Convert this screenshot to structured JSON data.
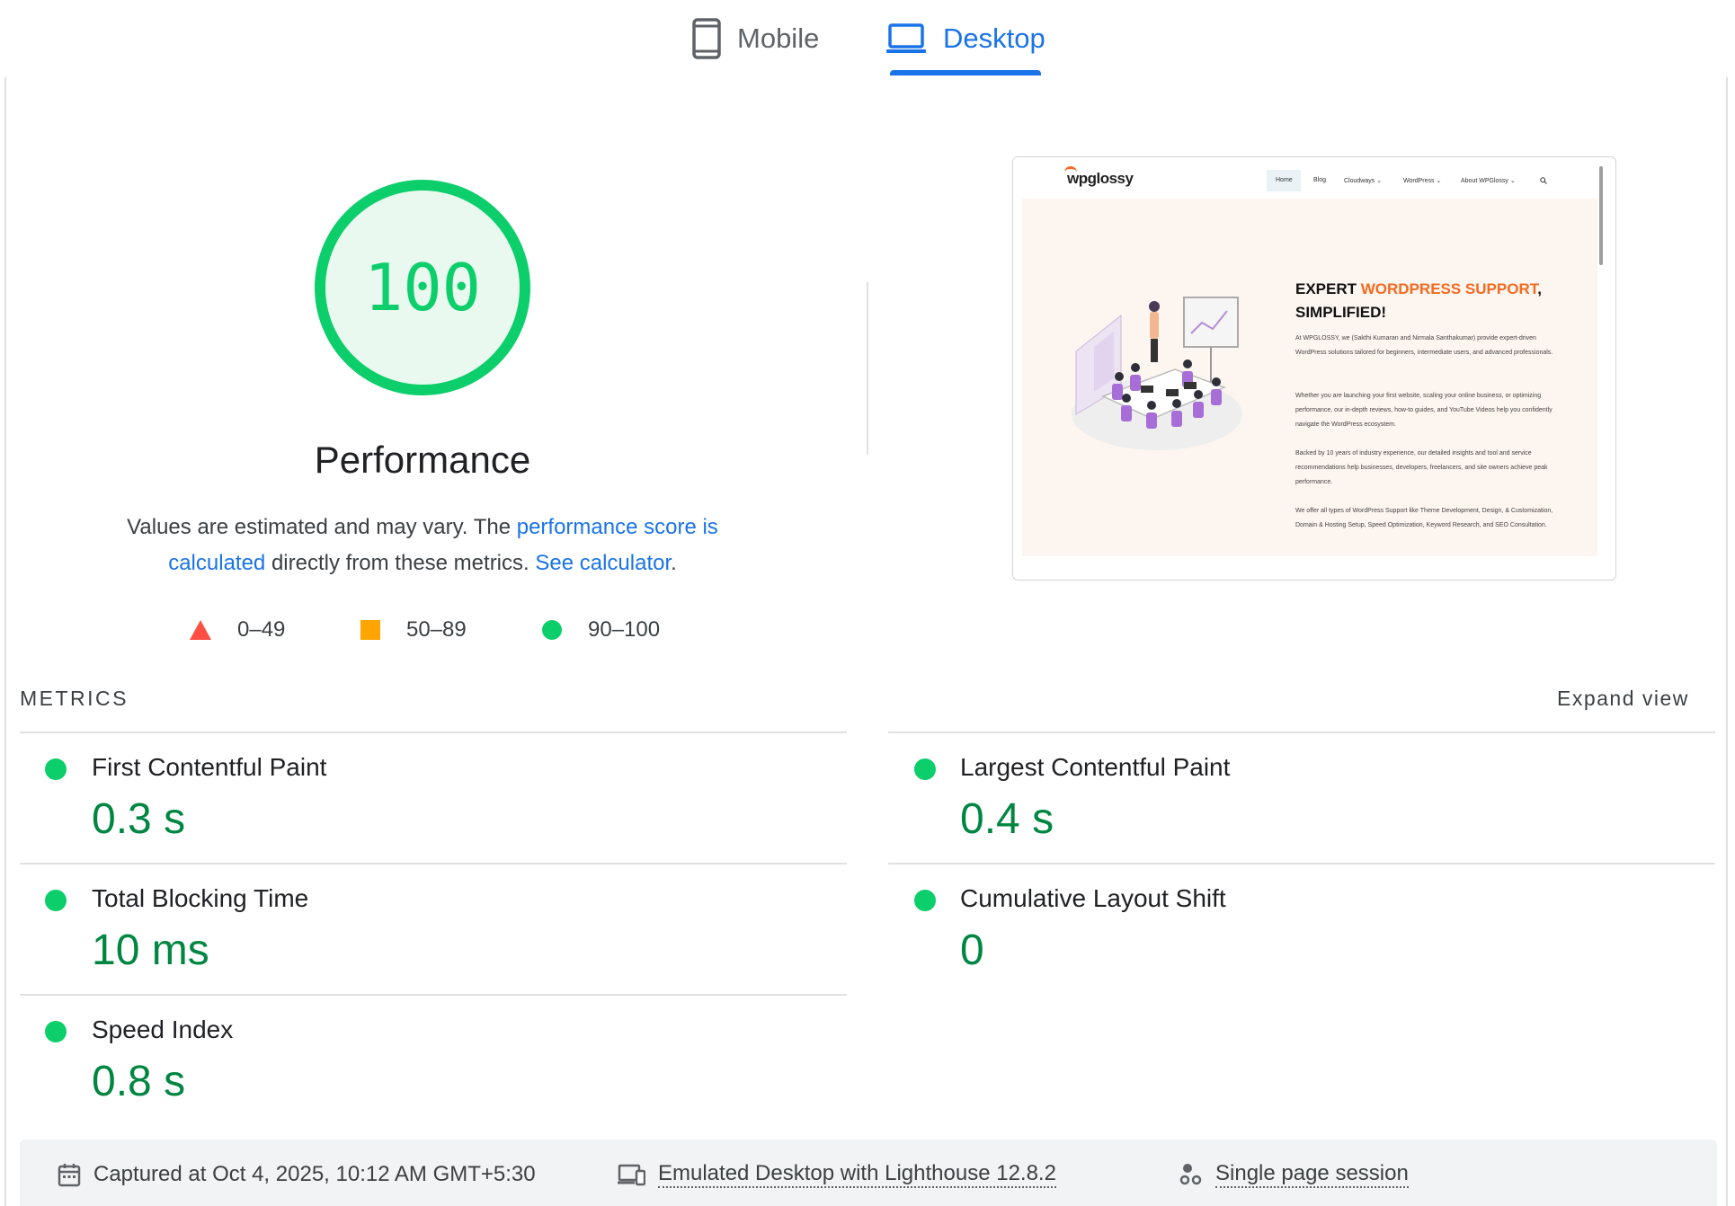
{
  "tabs": {
    "mobile": "Mobile",
    "desktop": "Desktop",
    "active": "desktop"
  },
  "gauge": {
    "score": "100",
    "category": "Performance",
    "color": "#0cce6b"
  },
  "description": {
    "prefix": "Values are estimated and may vary. The ",
    "link1": "performance score is calculated",
    "middle": " directly from these metrics. ",
    "link2": "See calculator",
    "suffix": "."
  },
  "legend": [
    {
      "icon": "red-triangle-icon",
      "range": "0–49",
      "color": "#ff4e42"
    },
    {
      "icon": "orange-square-icon",
      "range": "50–89",
      "color": "#ffa400"
    },
    {
      "icon": "green-circle-icon",
      "range": "90–100",
      "color": "#0cce6b"
    }
  ],
  "thumbnail": {
    "logo": "wpglossy",
    "nav": [
      "Home",
      "Blog",
      "Cloudways ⌄",
      "WordPress ⌄",
      "About WPGlossy ⌄"
    ],
    "headline_black_1": "EXPERT ",
    "headline_orange": "WORDPRESS SUPPORT",
    "headline_black_2": ",",
    "headline_line2": "SIMPLIFIED!",
    "para1": "At WPGLOSSY, we (Sakthi Kumaran and Nirmala Santhakumar) provide expert-driven WordPress solutions tailored for beginners, intermediate users, and advanced professionals.",
    "para2": "Whether you are launching your first website, scaling your online business, or optimizing performance, our in-depth reviews, how-to guides, and YouTube Videos help you confidently navigate the WordPress ecosystem.",
    "para3": "Backed by 10 years of industry experience, our detailed insights and tool and service recommendations help businesses, developers, freelancers, and site owners achieve peak performance.",
    "para4": "We offer all types of WordPress Support like Theme Development, Design, & Customization, Domain & Hosting Setup, Speed Optimization, Keyword Research, and SEO Consultation."
  },
  "metrics": {
    "header": "METRICS",
    "expand": "Expand view",
    "items": [
      {
        "label": "First Contentful Paint",
        "value": "0.3 s"
      },
      {
        "label": "Largest Contentful Paint",
        "value": "0.4 s"
      },
      {
        "label": "Total Blocking Time",
        "value": "10 ms"
      },
      {
        "label": "Cumulative Layout Shift",
        "value": "0"
      },
      {
        "label": "Speed Index",
        "value": "0.8 s"
      }
    ],
    "status_color": "#0cce6b",
    "value_color": "#018642"
  },
  "footer": {
    "captured": "Captured at Oct 4, 2025, 10:12 AM GMT+5:30",
    "emulated": "Emulated Desktop with Lighthouse 12.8.2",
    "session": "Single page session"
  }
}
